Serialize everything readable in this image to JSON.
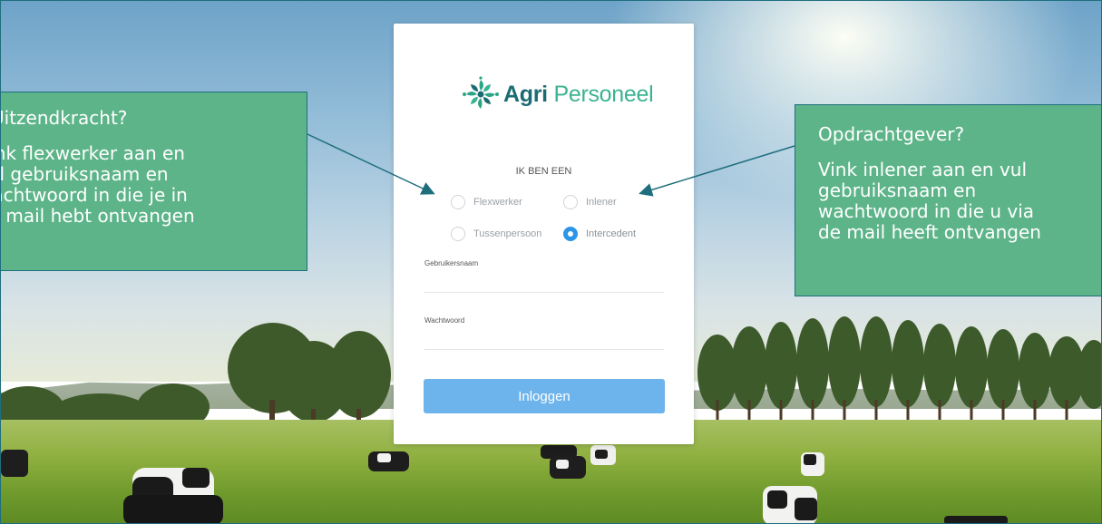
{
  "callouts": {
    "left": {
      "title": "Uitzendkracht?",
      "body": "Vink flexwerker aan en\nvul gebruiksnaam en\nwachtwoord in die je in\nde mail hebt ontvangen"
    },
    "right": {
      "title": "Opdrachtgever?",
      "body": "Vink inlener aan en vul\ngebruiksnaam en\nwachtwoord in die u via\nde mail heeft ontvangen"
    }
  },
  "login": {
    "logo_part1": "Agri",
    "logo_part2": "Personeel",
    "role_heading": "IK BEN EEN",
    "roles": [
      {
        "label": "Flexwerker",
        "checked": false
      },
      {
        "label": "Inlener",
        "checked": false
      },
      {
        "label": "Tussenpersoon",
        "checked": false
      },
      {
        "label": "Intercedent",
        "checked": true
      }
    ],
    "username_label": "Gebruikersnaam",
    "username_value": "",
    "password_label": "Wachtwoord",
    "password_value": "",
    "submit_label": "Inloggen"
  },
  "colors": {
    "callout_bg": "#5db489",
    "callout_border": "#1f6e7e",
    "button_bg": "#6db3ec",
    "radio_active": "#2c95e8",
    "logo_dark": "#1b6c72",
    "logo_light": "#3bb391"
  },
  "icons": {
    "logo": "agri-personeel-logo-icon"
  }
}
